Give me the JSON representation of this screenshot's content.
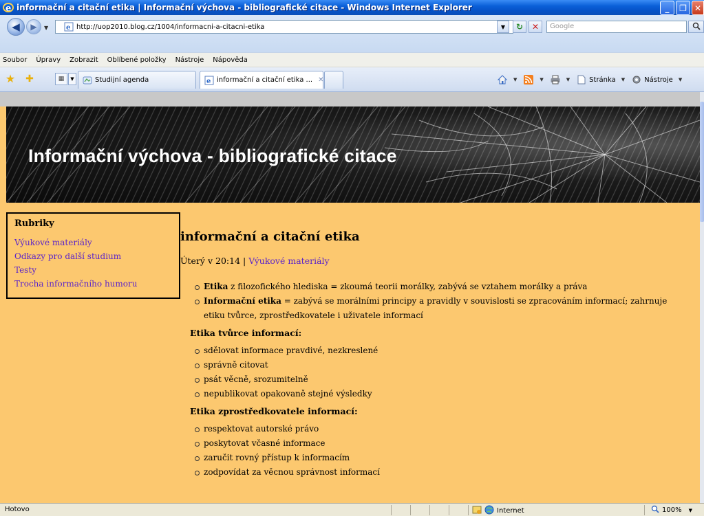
{
  "window": {
    "title": "informační a citační etika | Informační výchova - bibliografické citace - Windows Internet Explorer",
    "minimize": "_",
    "maximize": "❐",
    "close": "✕"
  },
  "address": {
    "url": "http://uop2010.blog.cz/1004/informacni-a-citacni-etika",
    "search_placeholder": "Google"
  },
  "menu": [
    "Soubor",
    "Úpravy",
    "Zobrazit",
    "Oblíbené položky",
    "Nástroje",
    "Nápověda"
  ],
  "tabs": [
    {
      "label": "Studijní agenda",
      "active": false
    },
    {
      "label": "informační a citační etika ...",
      "active": true
    }
  ],
  "commandbar": {
    "page": "Stránka",
    "tools": "Nástroje"
  },
  "banner": {
    "title": "Informační výchova - bibliografické citace"
  },
  "sidebar": {
    "heading": "Rubriky",
    "items": [
      "Výukové materiály",
      "Odkazy pro další studium",
      "Testy",
      "Trocha informačního humoru"
    ]
  },
  "article": {
    "title": "informační a citační etika",
    "date": "Úterý v 20:14 |",
    "category": "Výukové materiály",
    "intro": [
      {
        "bold": "Etika",
        "text": " z filozofického hlediska = zkoumá teorii morálky, zabývá se vztahem morálky a práva"
      },
      {
        "bold": "Informační etika",
        "text": " = zabývá se morálními principy a pravidly v souvislosti se zpracováním informací; zahrnuje etiku tvůrce, zprostředkovatele i uživatele informací"
      }
    ],
    "sections": [
      {
        "heading": "Etika tvůrce informací:",
        "items": [
          "sdělovat informace pravdivé, nezkreslené",
          "správně citovat",
          "psát věcně, srozumitelně",
          "nepublikovat opakovaně stejné výsledky"
        ]
      },
      {
        "heading": "Etika zprostředkovatele informací:",
        "items": [
          "respektovat autorské právo",
          "poskytovat včasné informace",
          "zaručit rovný přístup k informacím",
          "zodpovídat za věcnou správnost informací"
        ]
      }
    ]
  },
  "status": {
    "text": "Hotovo",
    "zone": "Internet",
    "zoom": "100%"
  },
  "colors": {
    "page_background": "#fcc86f",
    "link": "#5b23c9",
    "titlebar": "#0a5fd8"
  }
}
